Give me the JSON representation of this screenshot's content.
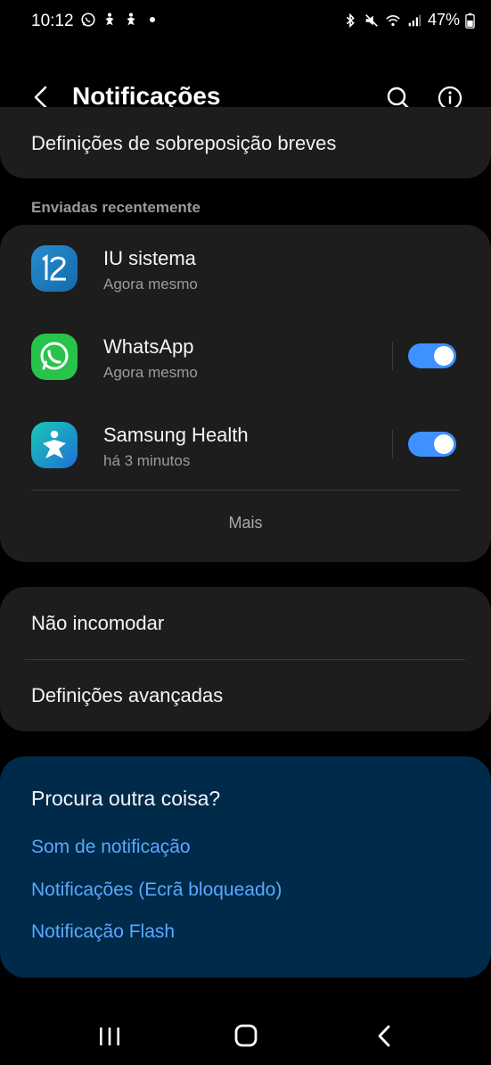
{
  "status_bar": {
    "time": "10:12",
    "battery": "47%",
    "left_icons": [
      "whatsapp-icon",
      "samsung-health-icon",
      "samsung-health-icon"
    ],
    "right_icons": [
      "bluetooth-icon",
      "mute-icon",
      "wifi-icon",
      "signal-icon",
      "battery-icon"
    ]
  },
  "header": {
    "title": "Notificações",
    "icons": [
      "back-arrow-icon",
      "search-icon",
      "info-icon"
    ]
  },
  "top_item": {
    "label": "Definições de sobreposição breves"
  },
  "recent": {
    "section_label": "Enviadas recentemente",
    "apps": [
      {
        "name": "IU sistema",
        "time": "Agora mesmo",
        "icon": "system-ui-icon",
        "has_toggle": false
      },
      {
        "name": "WhatsApp",
        "time": "Agora mesmo",
        "icon": "whatsapp-icon",
        "has_toggle": true,
        "enabled": true
      },
      {
        "name": "Samsung Health",
        "time": "há 3 minutos",
        "icon": "samsung-health-icon",
        "has_toggle": true,
        "enabled": true
      }
    ],
    "more_label": "Mais"
  },
  "settings": {
    "items": [
      "Não incomodar",
      "Definições avançadas"
    ]
  },
  "suggestions": {
    "title": "Procura outra coisa?",
    "links": [
      "Som de notificação",
      "Notificações (Ecrã bloqueado)",
      "Notificação Flash"
    ]
  },
  "colors": {
    "background": "#000000",
    "card": "#1d1d1d",
    "accent": "#3e91ff",
    "link": "#5aa9ff",
    "suggest_card": "#002a4a"
  }
}
